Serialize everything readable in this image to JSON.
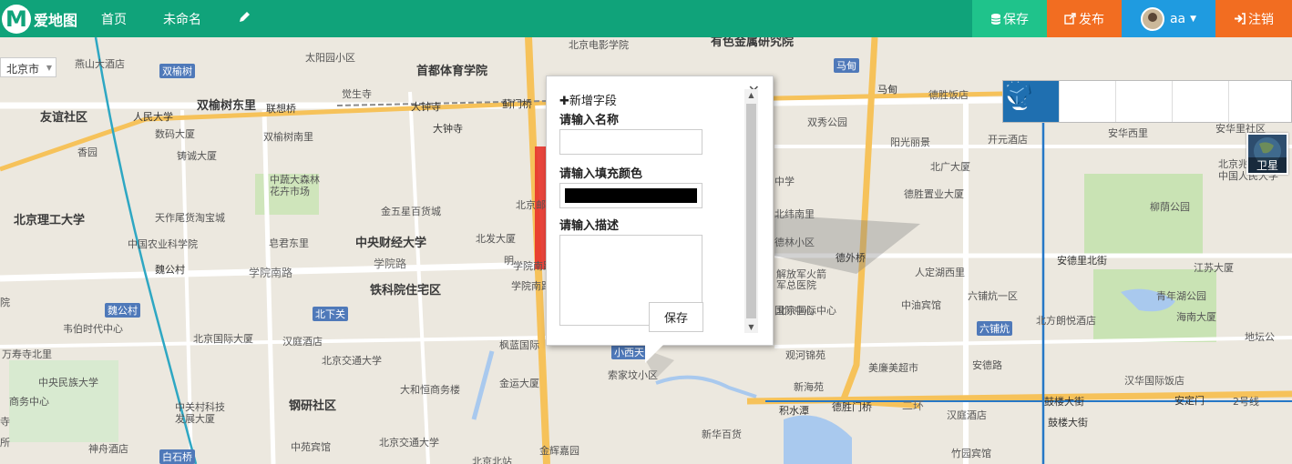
{
  "topbar": {
    "logo_letter": "M",
    "logo_text": "爱地图",
    "nav": [
      "首页",
      "未命名"
    ],
    "save_label": "保存",
    "publish_label": "发布",
    "user_name": "aa",
    "logout_label": "注销"
  },
  "map": {
    "city": "北京市",
    "satellite_label": "卫星",
    "labels": [
      {
        "t": "燕山大酒店",
        "c": "gray"
      },
      {
        "t": "双榆树",
        "c": "blue"
      },
      {
        "t": "首都体育学院",
        "c": "big"
      },
      {
        "t": "北京电影学院",
        "c": "gray"
      },
      {
        "t": "有色金属研究院",
        "c": "big"
      },
      {
        "t": "马甸",
        "c": "blue"
      },
      {
        "t": "太阳园小区",
        "c": "gray"
      },
      {
        "t": "觉生寺",
        "c": "gray"
      },
      {
        "t": "友谊社区",
        "c": "big"
      },
      {
        "t": "人民大学",
        "c": "lbl"
      },
      {
        "t": "双榆树东里",
        "c": "big"
      },
      {
        "t": "联想桥",
        "c": "lbl"
      },
      {
        "t": "大钟寺",
        "c": "lbl"
      },
      {
        "t": "蓟门桥",
        "c": "lbl"
      },
      {
        "t": "马甸",
        "c": "lbl"
      },
      {
        "t": "德胜饭店",
        "c": "gray"
      },
      {
        "t": "数码大厦",
        "c": "gray"
      },
      {
        "t": "双榆树南里",
        "c": "gray"
      },
      {
        "t": "大钟寺",
        "c": "lbl"
      },
      {
        "t": "双秀公园",
        "c": "gray"
      },
      {
        "t": "开元酒店",
        "c": "gray"
      },
      {
        "t": "安华西里",
        "c": "gray"
      },
      {
        "t": "安华里社区",
        "c": "gray"
      },
      {
        "t": "香园",
        "c": "gray"
      },
      {
        "t": "铸诚大厦",
        "c": "gray"
      },
      {
        "t": "阳光丽景",
        "c": "gray"
      },
      {
        "t": "北广大厦",
        "c": "gray"
      },
      {
        "t": "北京兆麟",
        "c": "gray"
      },
      {
        "t": "中国人民大学",
        "c": "gray"
      },
      {
        "t": "中蔬大森林",
        "c": "gray"
      },
      {
        "t": "花卉市场",
        "c": "gray"
      },
      {
        "t": "德胜置业大厦",
        "c": "gray"
      },
      {
        "t": "北京理工大学",
        "c": "big"
      },
      {
        "t": "天作尾货淘宝城",
        "c": "gray"
      },
      {
        "t": "金五星百货城",
        "c": "gray"
      },
      {
        "t": "柳荫公园",
        "c": "gray"
      },
      {
        "t": "中国农业科学院",
        "c": "gray"
      },
      {
        "t": "皂君东里",
        "c": "gray"
      },
      {
        "t": "中央财经大学",
        "c": "big"
      },
      {
        "t": "北发大厦",
        "c": "gray"
      },
      {
        "t": "德外桥",
        "c": "lbl"
      },
      {
        "t": "魏公村",
        "c": "lbl"
      },
      {
        "t": "学院南路",
        "c": "road"
      },
      {
        "t": "学院路",
        "c": "road"
      },
      {
        "t": "安德里北街",
        "c": "lbl"
      },
      {
        "t": "江苏大厦",
        "c": "gray"
      },
      {
        "t": "人定湖西里",
        "c": "gray"
      },
      {
        "t": "解放军火箭",
        "c": "gray"
      },
      {
        "t": "军总医院",
        "c": "gray"
      },
      {
        "t": "铁科院住宅区",
        "c": "big"
      },
      {
        "t": "学院南路",
        "c": "gray"
      },
      {
        "t": "青年湖公园",
        "c": "gray"
      },
      {
        "t": "六铺炕一区",
        "c": "gray"
      },
      {
        "t": "中油宾馆",
        "c": "gray"
      },
      {
        "t": "海南大厦",
        "c": "gray"
      },
      {
        "t": "魏公村",
        "c": "blue"
      },
      {
        "t": "北下关",
        "c": "blue"
      },
      {
        "t": "韦伯时代中心",
        "c": "gray"
      },
      {
        "t": "北京国际大厦",
        "c": "gray"
      },
      {
        "t": "北京国际中心",
        "c": "gray"
      },
      {
        "t": "北方朗悦酒店",
        "c": "gray"
      },
      {
        "t": "六铺炕",
        "c": "blue"
      },
      {
        "t": "万寿寺北里",
        "c": "gray"
      },
      {
        "t": "汉庭酒店",
        "c": "gray"
      },
      {
        "t": "枫蓝国际",
        "c": "gray"
      },
      {
        "t": "小西天",
        "c": "blue"
      },
      {
        "t": "观河锦苑",
        "c": "gray"
      },
      {
        "t": "美廉美超市",
        "c": "gray"
      },
      {
        "t": "安德路",
        "c": "gray"
      },
      {
        "t": "地坛公",
        "c": "gray"
      },
      {
        "t": "北京交通大学",
        "c": "gray"
      },
      {
        "t": "中央民族大学",
        "c": "gray"
      },
      {
        "t": "金运大厦",
        "c": "gray"
      },
      {
        "t": "索家坟小区",
        "c": "gray"
      },
      {
        "t": "新海苑",
        "c": "gray"
      },
      {
        "t": "汉华国际饭店",
        "c": "gray"
      },
      {
        "t": "商务中心",
        "c": "gray"
      },
      {
        "t": "大和恒商务楼",
        "c": "gray"
      },
      {
        "t": "钢研社区",
        "c": "big"
      },
      {
        "t": "积水潭",
        "c": "lbl"
      },
      {
        "t": "德胜门桥",
        "c": "lbl"
      },
      {
        "t": "二环",
        "c": "road"
      },
      {
        "t": "鼓楼大街",
        "c": "lbl"
      },
      {
        "t": "安定门",
        "c": "lbl"
      },
      {
        "t": "2号线",
        "c": "gray"
      },
      {
        "t": "中关村科技",
        "c": "gray"
      },
      {
        "t": "发展大厦",
        "c": "gray"
      },
      {
        "t": "新华百货",
        "c": "gray"
      },
      {
        "t": "汉庭酒店",
        "c": "gray"
      },
      {
        "t": "鼓楼大街",
        "c": "lbl"
      },
      {
        "t": "神舟酒店",
        "c": "gray"
      },
      {
        "t": "中苑宾馆",
        "c": "gray"
      },
      {
        "t": "北京交通大学",
        "c": "gray"
      },
      {
        "t": "金辉嘉园",
        "c": "gray"
      },
      {
        "t": "白石桥",
        "c": "blue"
      },
      {
        "t": "竹园宾馆",
        "c": "gray"
      },
      {
        "t": "北京北站",
        "c": "gray"
      },
      {
        "t": "学院南路",
        "c": "gray"
      },
      {
        "t": "明",
        "c": "gray"
      },
      {
        "t": "北京邮",
        "c": "gray"
      },
      {
        "t": "寺",
        "c": "gray"
      },
      {
        "t": "院",
        "c": "gray"
      },
      {
        "t": "所",
        "c": "gray"
      },
      {
        "t": "中学",
        "c": "gray"
      },
      {
        "t": "北纬南里",
        "c": "gray"
      },
      {
        "t": "德林小区",
        "c": "gray"
      },
      {
        "t": "国际中心",
        "c": "gray"
      }
    ]
  },
  "popup": {
    "add_field": "新增字段",
    "name_label": "请输入名称",
    "color_label": "请输入填充颜色",
    "color_value": "#000000",
    "desc_label": "请输入描述",
    "save_label": "保存"
  }
}
